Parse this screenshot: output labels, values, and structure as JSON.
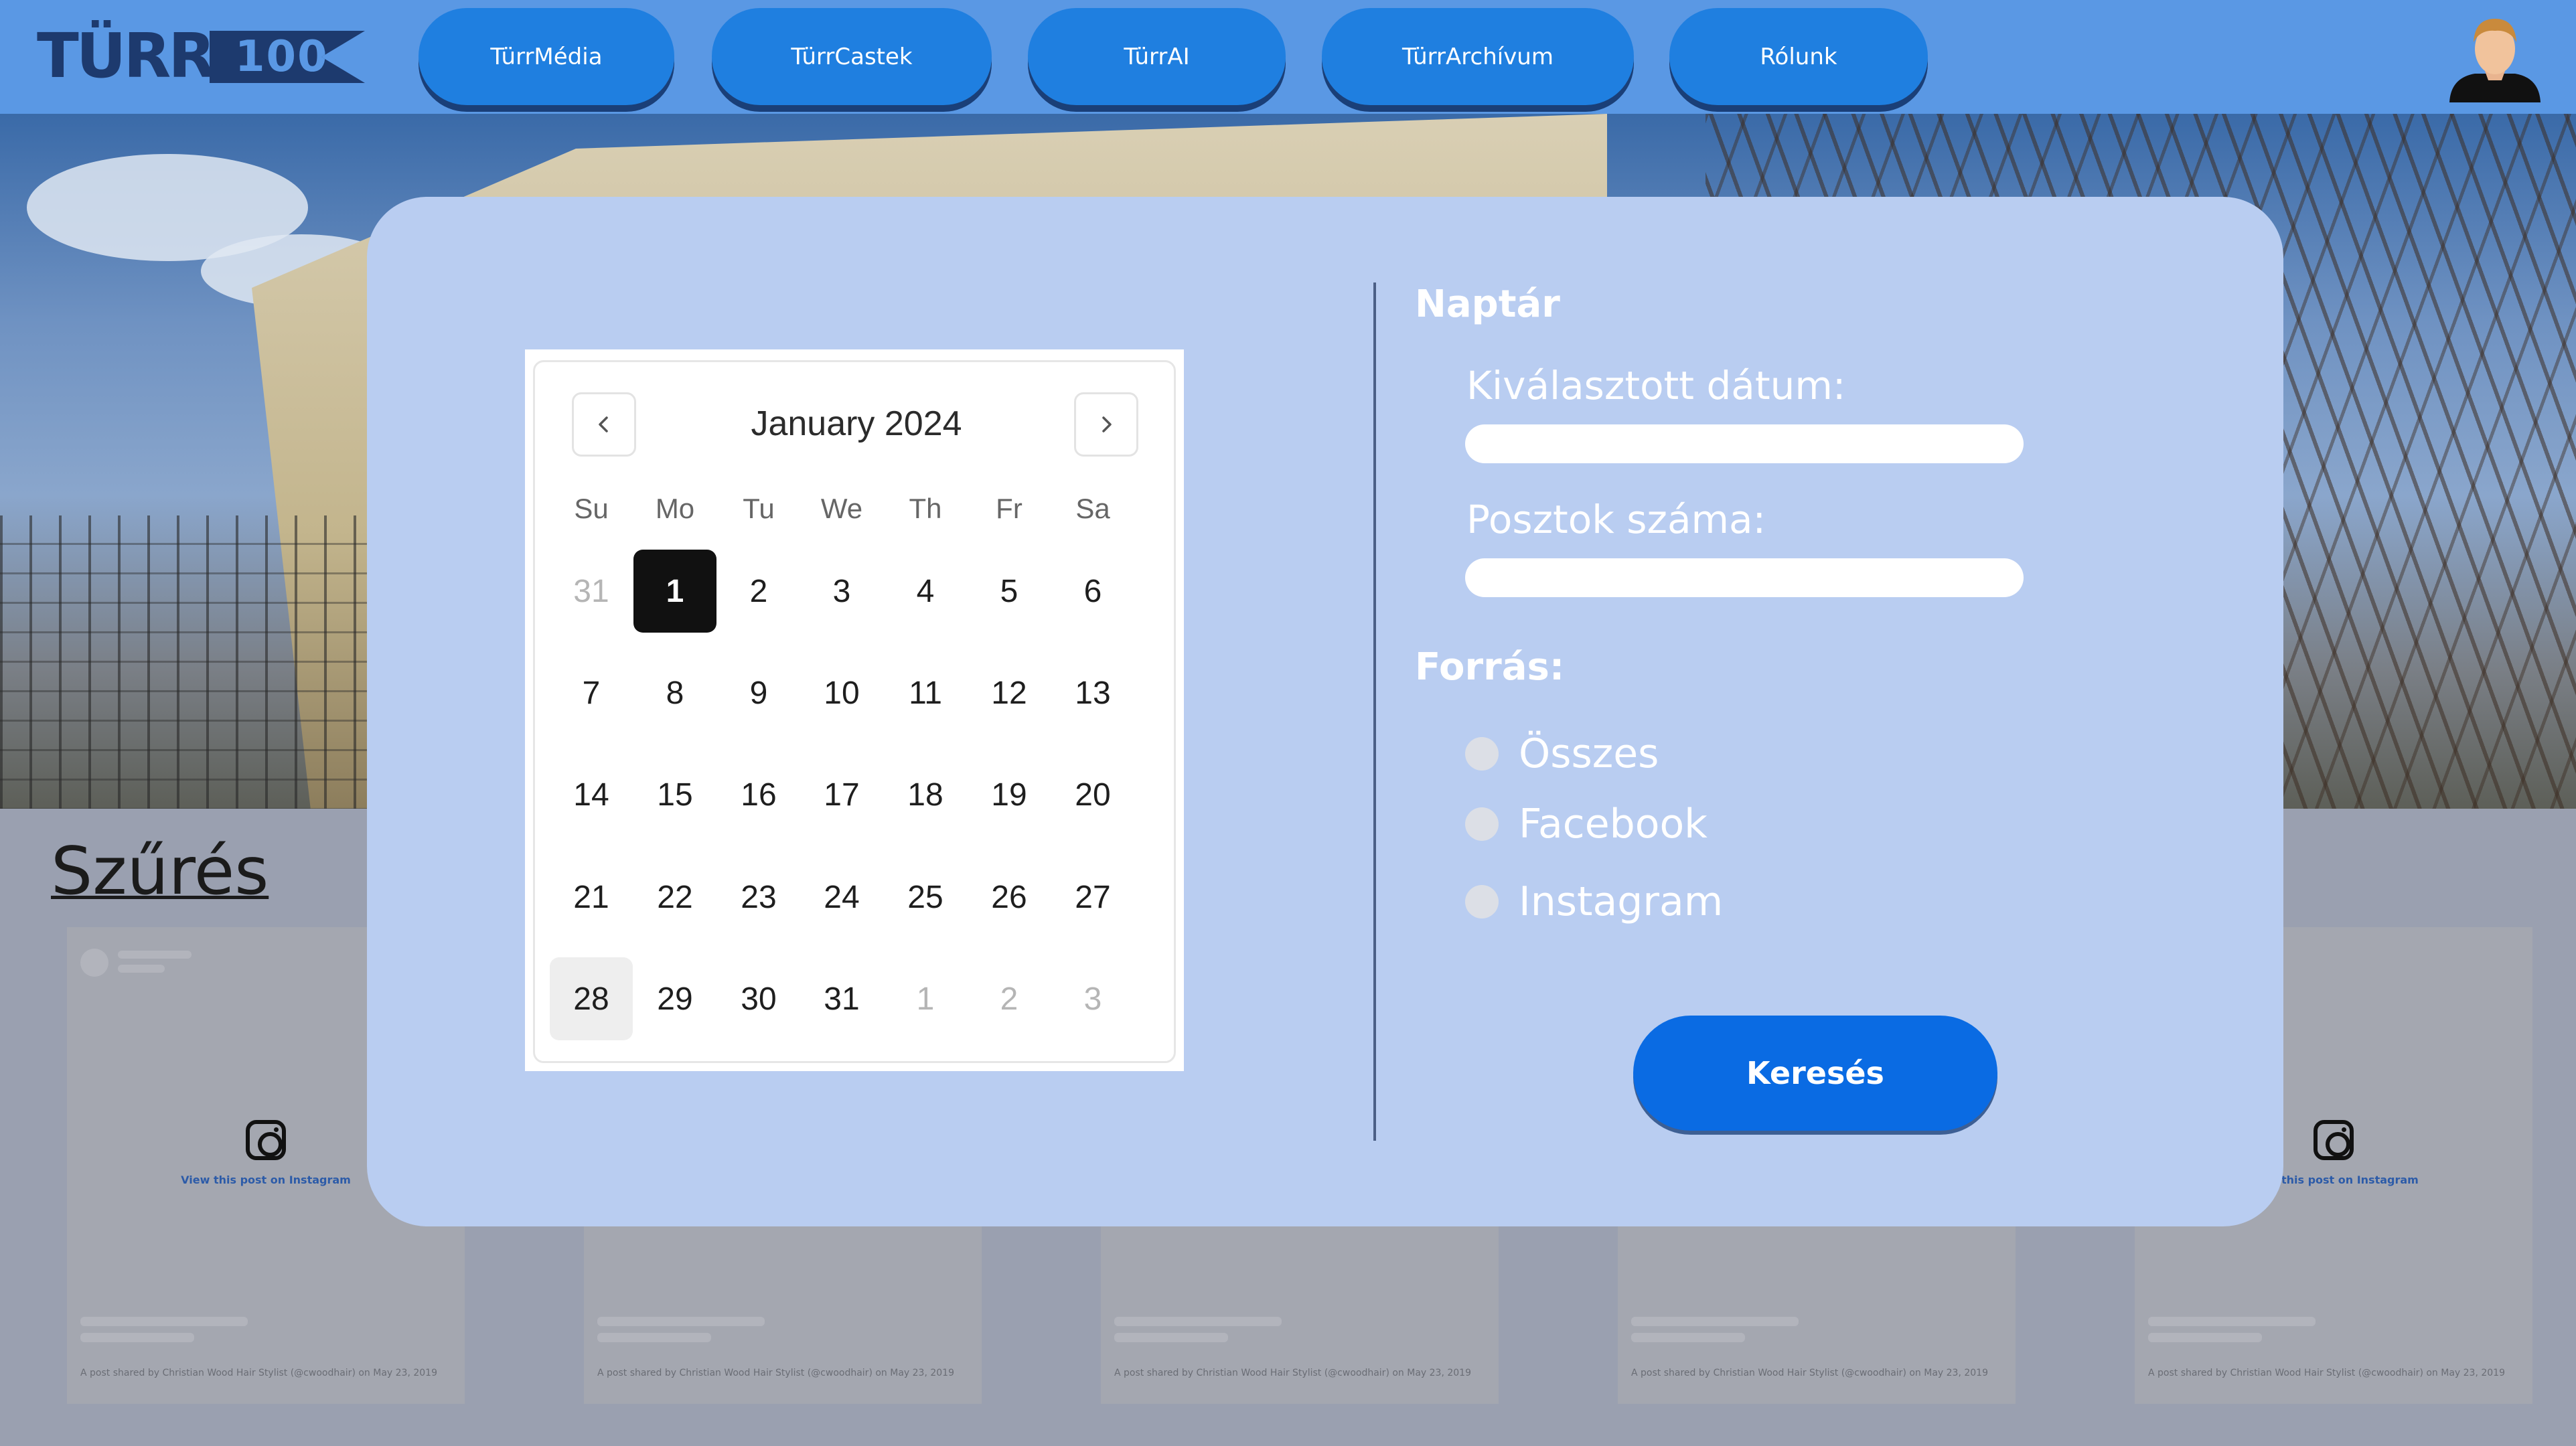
{
  "header": {
    "logo_text_1": "TÜRR",
    "logo_text_2": "100",
    "nav": [
      {
        "label": "TürrMédia"
      },
      {
        "label": "TürrCastek"
      },
      {
        "label": "TürrAI"
      },
      {
        "label": "TürrArchívum"
      },
      {
        "label": "Rólunk"
      }
    ],
    "avatar_icon": "user-avatar-icon"
  },
  "filter": {
    "title": "Szűrés"
  },
  "cards": [
    {
      "link_text": "View this post on Instagram",
      "caption": "A post shared by Christian Wood Hair Stylist (@cwoodhair) on May 23, 2019"
    },
    {
      "link_text": "",
      "caption": "A post shared by Christian Wood Hair Stylist (@cwoodhair) on May 23, 2019"
    },
    {
      "link_text": "",
      "caption": "A post shared by Christian Wood Hair Stylist (@cwoodhair) on May 23, 2019"
    },
    {
      "link_text": "",
      "caption": "A post shared by Christian Wood Hair Stylist (@cwoodhair) on May 23, 2019"
    },
    {
      "link_text": "View this post on Instagram",
      "caption": "A post shared by Christian Wood Hair Stylist (@cwoodhair) on May 23, 2019"
    }
  ],
  "calendar": {
    "month_label": "January 2024",
    "prev_icon": "chevron-left-icon",
    "next_icon": "chevron-right-icon",
    "weekdays": [
      "Su",
      "Mo",
      "Tu",
      "We",
      "Th",
      "Fr",
      "Sa"
    ],
    "selected_day": "1",
    "today_day": "28",
    "weeks": [
      [
        "31",
        "1",
        "2",
        "3",
        "4",
        "5",
        "6"
      ],
      [
        "7",
        "8",
        "9",
        "10",
        "11",
        "12",
        "13"
      ],
      [
        "14",
        "15",
        "16",
        "17",
        "18",
        "19",
        "20"
      ],
      [
        "21",
        "22",
        "23",
        "24",
        "25",
        "26",
        "27"
      ],
      [
        "28",
        "29",
        "30",
        "31",
        "1",
        "2",
        "3"
      ]
    ],
    "muted": [
      [
        true,
        false,
        false,
        false,
        false,
        false,
        false
      ],
      [
        false,
        false,
        false,
        false,
        false,
        false,
        false
      ],
      [
        false,
        false,
        false,
        false,
        false,
        false,
        false
      ],
      [
        false,
        false,
        false,
        false,
        false,
        false,
        false
      ],
      [
        false,
        false,
        false,
        false,
        true,
        true,
        true
      ]
    ]
  },
  "panel": {
    "title": "Naptár",
    "selected_date_label": "Kiválasztott dátum:",
    "selected_date_value": "",
    "post_count_label": "Posztok száma:",
    "post_count_value": "",
    "source_title": "Forrás:",
    "sources": [
      {
        "label": "Összes",
        "checked": false
      },
      {
        "label": "Facebook",
        "checked": false
      },
      {
        "label": "Instagram",
        "checked": false
      }
    ],
    "search_label": "Keresés"
  },
  "colors": {
    "header_bg": "#5a98e4",
    "nav_button": "#1f7fe0",
    "modal_bg": "#b9cdf1",
    "search_button": "#0a6be3",
    "selected_day_bg": "#111111"
  }
}
